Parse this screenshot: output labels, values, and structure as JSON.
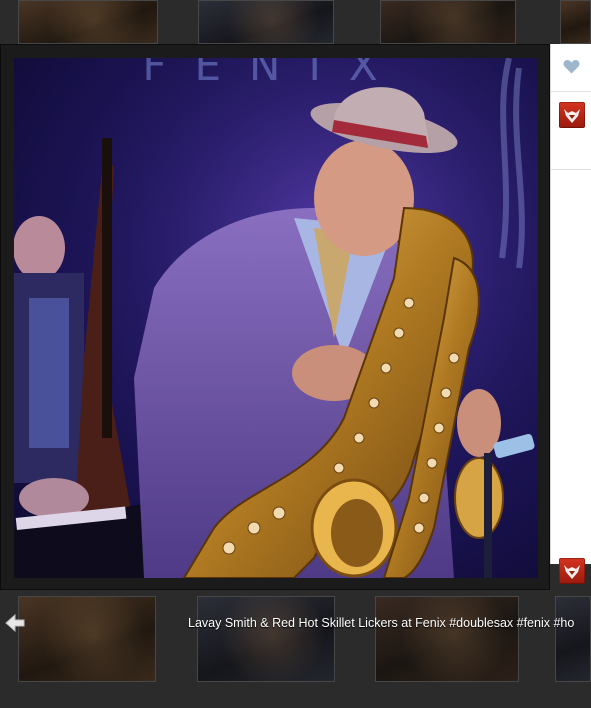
{
  "caption": {
    "text": "Lavay Smith & Red Hot Skillet Lickers at Fenix #doublesax #fenix #ho"
  },
  "photo": {
    "sign_text": "FENIX"
  },
  "colors": {
    "stage_purple": "#241a6a",
    "side_panel": "#ffffff",
    "heart": "#9cb6cc",
    "avatar_red": "#c92a18"
  },
  "icons": {
    "like": "heart-icon",
    "previous": "left-arrow-icon",
    "avatar": "avatar-icon"
  }
}
